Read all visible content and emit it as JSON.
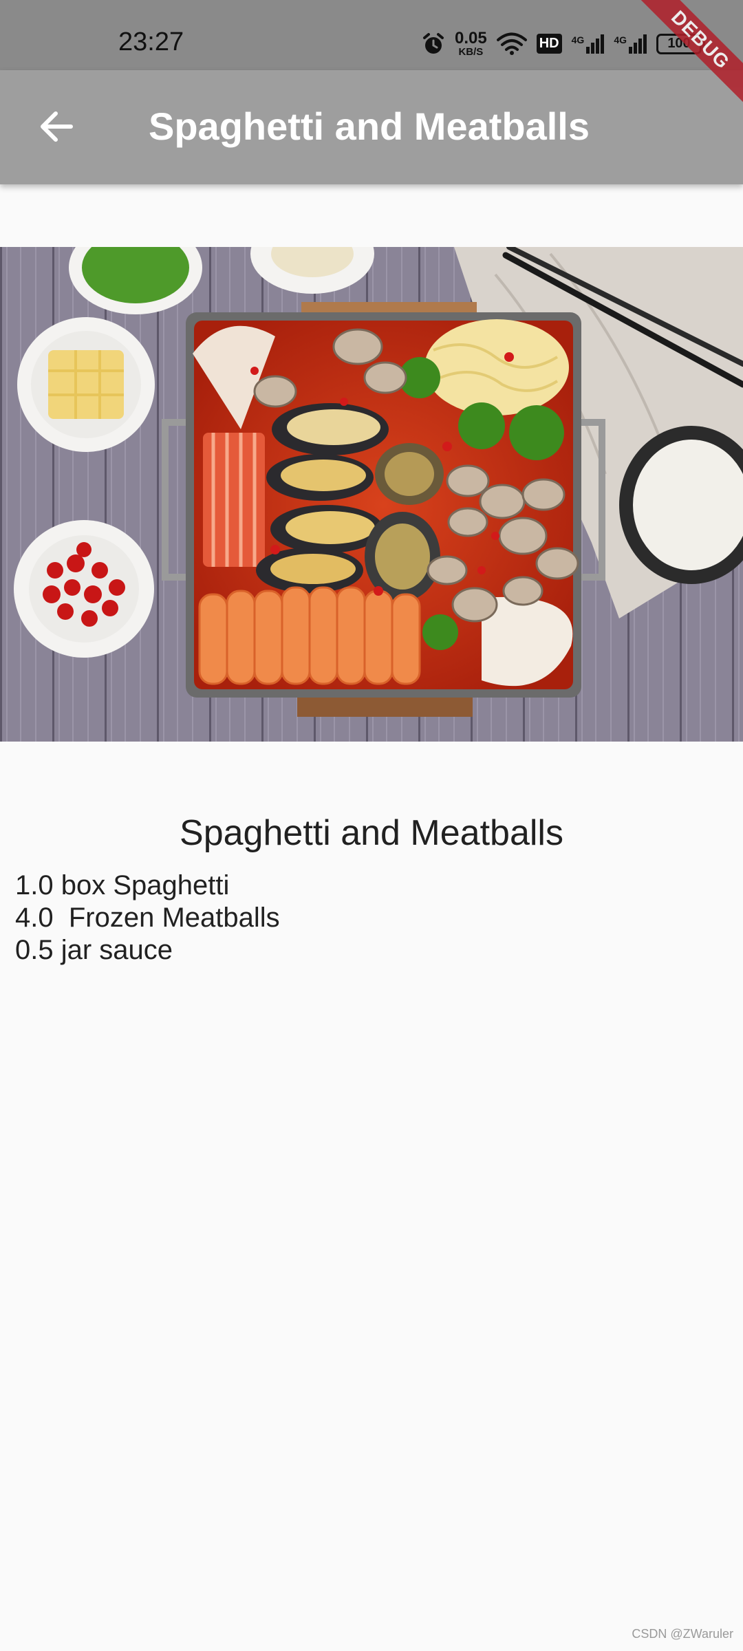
{
  "status_bar": {
    "time": "23:27",
    "net_speed_value": "0.05",
    "net_speed_unit": "KB/S",
    "hd_label": "HD",
    "signal_1_tag": "4G",
    "signal_2_tag": "4G",
    "battery": "100"
  },
  "debug_banner": "DEBUG",
  "app_bar": {
    "title": "Spaghetti and Meatballs",
    "back_icon": "arrow-back-icon"
  },
  "hero_image": {
    "description_icon": "food-photo"
  },
  "recipe": {
    "title": "Spaghetti and Meatballs",
    "ingredients": [
      "1.0 box Spaghetti",
      "4.0  Frozen Meatballs",
      "0.5 jar sauce"
    ]
  },
  "watermark": "CSDN @ZWaruler",
  "colors": {
    "status_bar": "#8a8a8a",
    "app_bar": "#9e9e9e",
    "background": "#fafafa",
    "debug_banner": "#b0202a"
  }
}
